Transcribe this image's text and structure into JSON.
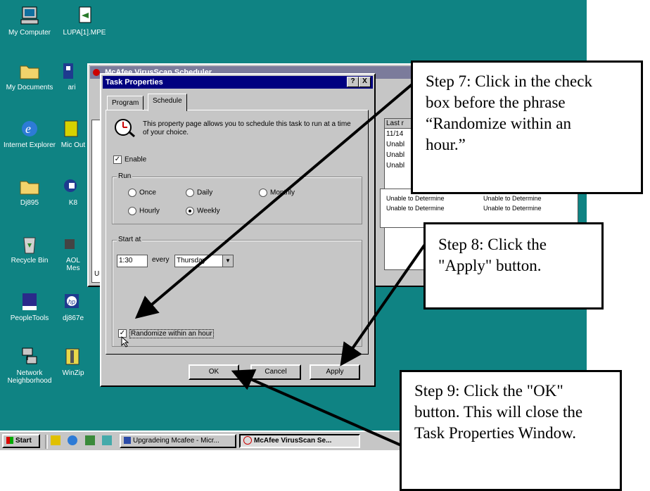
{
  "desktop": {
    "icons": [
      {
        "label": "My Computer",
        "icon": "computer-icon"
      },
      {
        "label": "LUPA[1].MPE",
        "icon": "file-icon"
      },
      {
        "label": "My Documents",
        "icon": "folder-icon"
      },
      {
        "label": "ari",
        "icon": "app-icon"
      },
      {
        "label": "Internet Explorer",
        "icon": "ie-icon"
      },
      {
        "label": "Mic Out",
        "icon": "outlook-icon"
      },
      {
        "label": "Dj895",
        "icon": "folder-icon"
      },
      {
        "label": "K8",
        "icon": "app-icon"
      },
      {
        "label": "Recycle Bin",
        "icon": "recycle-bin-icon"
      },
      {
        "label": "AOL Mes",
        "icon": "aol-icon"
      },
      {
        "label": "PeopleTools",
        "icon": "peopletools-icon"
      },
      {
        "label": "dj867e",
        "icon": "hp-icon"
      },
      {
        "label": "Network Neighborhood",
        "icon": "network-icon"
      },
      {
        "label": "WinZip",
        "icon": "winzip-icon"
      }
    ]
  },
  "scheduler_window": {
    "title": "McAfee VirusScan Scheduler",
    "list_header": "Last r",
    "rows": [
      "11/14",
      "Unabl",
      "Unabl",
      "Unabl",
      "Unable to Determine",
      "Unable to Determine"
    ],
    "rows_col2": [
      "Unable to Determine",
      "Unable to Determine"
    ],
    "side_letters": "Ur"
  },
  "dialog": {
    "title": "Task Properties",
    "help_btn": "?",
    "close_btn": "X",
    "tabs": [
      "Program",
      "Schedule"
    ],
    "description": "This property page allows you to schedule this task to run at a time of your choice.",
    "enable_label": "Enable",
    "run_group": "Run",
    "run_options": {
      "once": "Once",
      "daily": "Daily",
      "monthly": "Monthly",
      "hourly": "Hourly",
      "weekly": "Weekly"
    },
    "start_group": "Start at",
    "time_value": "1:30",
    "every_label": "every",
    "day_value": "Thursday",
    "randomize_label": "Randomize within an hour",
    "ok": "OK",
    "cancel": "Cancel",
    "apply": "Apply"
  },
  "taskbar": {
    "start": "Start",
    "items": [
      "Upgradeing Mcafee - Micr...",
      "McAfee VirusScan Se..."
    ]
  },
  "callouts": {
    "step7": "Step 7: Click in the check box before the phrase “Randomize within an hour.”",
    "step8": "Step 8: Click the \"Apply\" button.",
    "step9": "Step 9: Click the \"OK\" button. This will close the Task Properties Window."
  },
  "colors": {
    "desktop": "#0f8383",
    "titlebar": "#000080",
    "face": "#c6c6c6"
  }
}
